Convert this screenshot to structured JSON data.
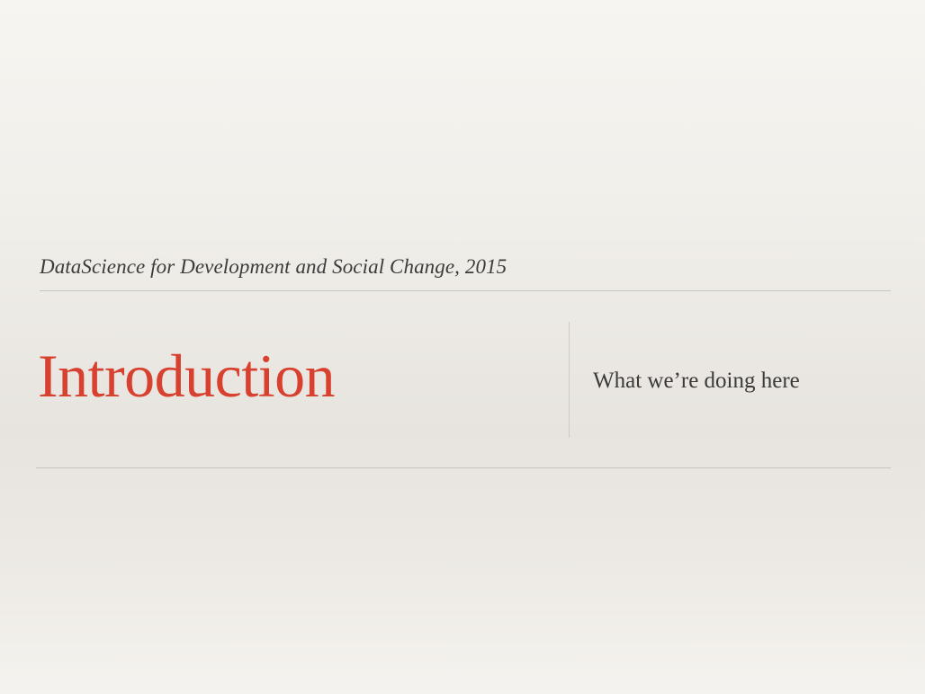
{
  "slide": {
    "course_line": "DataScience for Development and Social Change, 2015",
    "title": "Introduction",
    "subtitle": "What we’re doing here"
  },
  "colors": {
    "title_accent": "#d8412f",
    "body_text": "#3a3a3a",
    "rule": "#c8c4be",
    "background": "#f1efea"
  }
}
